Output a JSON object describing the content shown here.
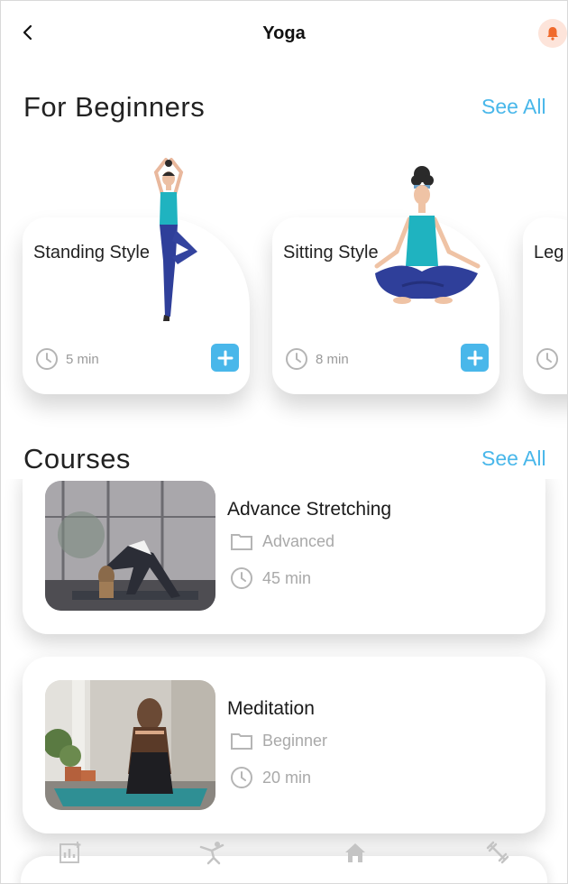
{
  "header": {
    "title": "Yoga",
    "back_icon": "chevron-left-icon",
    "notification_icon": "bell-icon",
    "notification_color": "#f06a2c"
  },
  "beginners": {
    "title": "For Beginners",
    "see_all": "See All",
    "cards": [
      {
        "label": "Standing Style",
        "duration": "5 min",
        "illustration": "standing-yoga-pose"
      },
      {
        "label": "Sitting Style",
        "duration": "8 min",
        "illustration": "sitting-yoga-pose"
      },
      {
        "label": "Leg",
        "duration": ""
      }
    ]
  },
  "courses": {
    "title": "Courses",
    "see_all": "See All",
    "items": [
      {
        "name": "Advance Stretching",
        "level": "Advanced",
        "duration": "45 min",
        "photo": "stretching-photo"
      },
      {
        "name": "Meditation",
        "level": "Beginner",
        "duration": "20 min",
        "photo": "meditation-photo"
      }
    ]
  },
  "bottom_nav": [
    {
      "icon": "stats-icon"
    },
    {
      "icon": "yoga-icon"
    },
    {
      "icon": "home-icon"
    },
    {
      "icon": "dumbbell-icon"
    }
  ],
  "colors": {
    "accent": "#49b7ea",
    "text_primary": "#222222",
    "text_muted": "#a9a9a9",
    "notification_bg": "#fde4da"
  }
}
